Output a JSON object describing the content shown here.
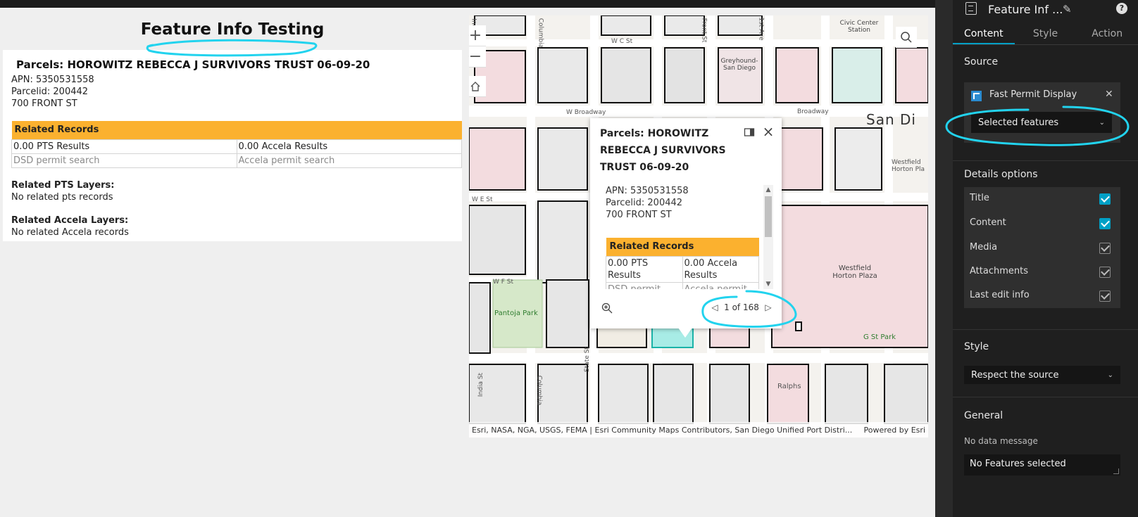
{
  "canvas": {
    "title": "Feature Info Testing",
    "feature": {
      "heading": "Parcels: HOROWITZ REBECCA J SURVIVORS TRUST 06-09-20",
      "apn": "APN: 5350531558",
      "parcelid": "Parcelid: 200442",
      "address": "700 FRONT ST",
      "related_records_header": "Related Records",
      "pts_results": "0.00 PTS Results",
      "accela_results": "0.00 Accela Results",
      "dsd_link": "DSD permit search",
      "accela_link": "Accela permit search",
      "pts_layers_title": "Related PTS Layers:",
      "pts_layers_text": "No related pts records",
      "accela_layers_title": "Related Accela Layers:",
      "accela_layers_text": "No related Accela records"
    }
  },
  "map": {
    "zoom_in": "+",
    "zoom_out": "−",
    "labels": {
      "columbia": "Columbia",
      "inc": "Inc",
      "front_st": "Front St",
      "first_ave": "1st Ave",
      "wc_st": "W C St",
      "civic_center": "Civic Center Station",
      "greyhound": "Greyhound-San Diego",
      "w_broadway": "W Broadway",
      "broadway": "Broadway",
      "san_diego": "San Di",
      "westfield_top": "Westfield Horton Pla",
      "we_st": "W E St",
      "wf_st": "W F St",
      "pantoja_park": "Pantoja Park",
      "westfield_horton": "Westfield Horton Plaza",
      "g_st_park": "G St Park",
      "state_st": "State St",
      "india_st": "India St",
      "columbia2": "Columbia",
      "ralphs": "Ralphs"
    },
    "attribution": "Esri, NASA, NGA, USGS, FEMA | Esri Community Maps Contributors, San Diego Unified Port Distri...",
    "powered_by": "Powered by Esri"
  },
  "popup": {
    "title": "Parcels: HOROWITZ REBECCA J SURVIVORS TRUST 06-09-20",
    "apn": "APN: 5350531558",
    "parcelid": "Parcelid: 200442",
    "address": "700 FRONT ST",
    "related_records_header": "Related Records",
    "pts_results": "0.00 PTS Results",
    "accela_results": "0.00 Accela Results",
    "dsd_link": "DSD permit",
    "accela_link": "Accela permit",
    "pager": "1 of 168"
  },
  "panel": {
    "widget_name": "Feature Inf ...",
    "help": "?",
    "tabs": [
      "Content",
      "Style",
      "Action"
    ],
    "source_label": "Source",
    "source_name": "Fast Permit Display",
    "source_mode": "Selected features",
    "details_label": "Details options",
    "options": [
      {
        "label": "Title",
        "checked": true
      },
      {
        "label": "Content",
        "checked": true
      },
      {
        "label": "Media",
        "checked": false
      },
      {
        "label": "Attachments",
        "checked": false
      },
      {
        "label": "Last edit info",
        "checked": false
      }
    ],
    "style_label": "Style",
    "style_value": "Respect the source",
    "general_label": "General",
    "no_data_label": "No data message",
    "no_data_value": "No Features selected"
  },
  "colors": {
    "accent": "#00a0c6",
    "records_header": "#fbb12f",
    "annotation": "#22d3ee",
    "selected_parcel": "#a8ece6"
  }
}
